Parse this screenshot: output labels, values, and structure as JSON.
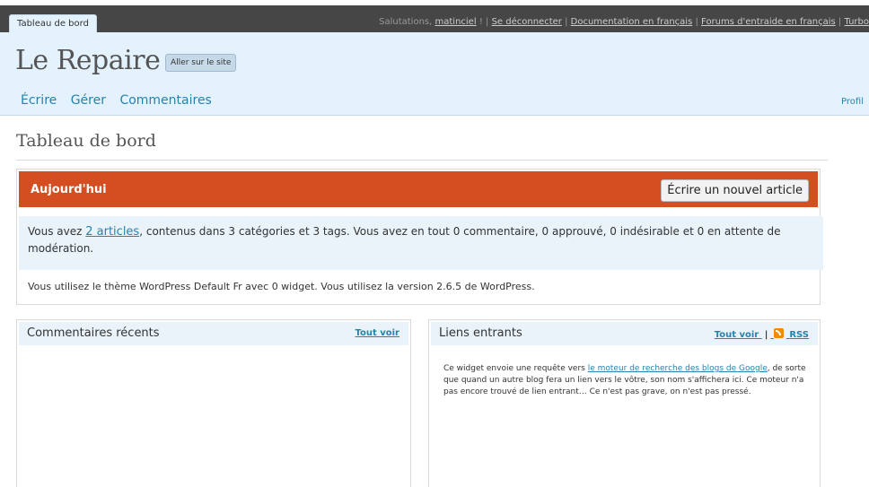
{
  "topbar": {
    "tab_label": "Tableau de bord",
    "greeting": "Salutations,",
    "username": "matinciel",
    "bang": "!",
    "logout": "Se déconnecter",
    "docs": "Documentation en français",
    "forums": "Forums d'entraide en français",
    "turbo": "Turbo"
  },
  "header": {
    "site_title": "Le Repaire",
    "visit_button": "Aller sur le site",
    "nav": [
      "Écrire",
      "Gérer",
      "Commentaires"
    ],
    "profile": "Profil"
  },
  "page": {
    "title": "Tableau de bord"
  },
  "today": {
    "title": "Aujourd'hui",
    "new_article_button": "Écrire un nouvel article",
    "stats_prefix": "Vous avez ",
    "stats_link": "2 articles",
    "stats_suffix": ", contenus dans 3 catégories et 3 tags. Vous avez en tout 0 commentaire, 0 approuvé, 0 indésirable et 0 en attente de modération.",
    "version_text": "Vous utilisez le thème WordPress Default Fr avec 0 widget. Vous utilisez la version 2.6.5 de WordPress."
  },
  "recent_comments": {
    "title": "Commentaires récents",
    "view_all": "Tout voir"
  },
  "incoming_links": {
    "title": "Liens entrants",
    "view_all": "Tout voir",
    "separator": "|",
    "rss": "RSS",
    "text_prefix": "Ce widget envoie une requête vers ",
    "text_link": "le moteur de recherche des blogs de Google",
    "text_suffix": ", de sorte que quand un autre blog fera un lien vers le vôtre, son nom s'affichera ici. Ce moteur n'a pas encore trouvé de lien entrant… Ce n'est pas grave, on n'est pas pressé."
  },
  "colors": {
    "header_bg": "#e4f2fd",
    "accent": "#d54e21",
    "link": "#2583ad",
    "topbar": "#464646"
  }
}
